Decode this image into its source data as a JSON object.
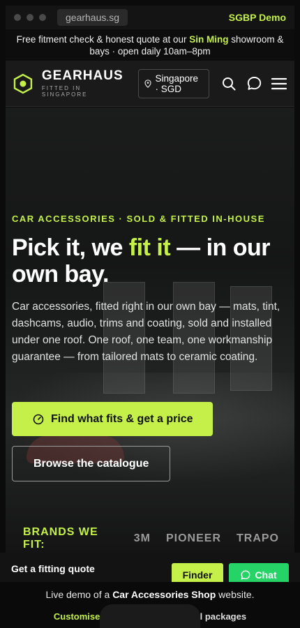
{
  "browser": {
    "url": "gearhaus.sg",
    "demo_label": "SGBP Demo"
  },
  "announcement": {
    "before": "Free fitment check & honest quote at our ",
    "highlight": "Sin Ming",
    "after": " showroom & bays · open daily 10am–8pm"
  },
  "header": {
    "brand_name": "GEARHAUS",
    "brand_tagline": "FITTED IN SINGAPORE",
    "region_label": "Singapore · SGD",
    "icons": [
      "search-icon",
      "chat-icon",
      "menu-icon"
    ]
  },
  "hero": {
    "eyebrow": "CAR ACCESSORIES · SOLD & FITTED IN-HOUSE",
    "headline_before": "Pick it, we ",
    "headline_highlight": "fit it",
    "headline_after": " — in our own bay.",
    "lede": "Car accessories, fitted right in our own bay — mats, tint, dashcams, audio, trims and coating, sold and installed under one roof. One roof, one team, one workmanship guarantee — from tailored mats to ceramic coating.",
    "primary_cta": "Find what fits & get a price",
    "secondary_cta": "Browse the catalogue"
  },
  "brands": {
    "label": "BRANDS WE FIT:",
    "items": [
      "3M",
      "PIONEER",
      "TRAPO"
    ]
  },
  "quote_bar": {
    "title": "Get a fitting quote",
    "finder_label": "Finder",
    "chat_label": "Chat"
  },
  "demo_bar": {
    "before": "Live demo of a ",
    "bold": "Car Accessories Shop",
    "after": " website.",
    "customise_link": "Customise & buy this site →",
    "packages_link": "All packages"
  },
  "colors": {
    "accent": "#c4f049",
    "whatsapp": "#25d366",
    "background": "#0b0b0b"
  }
}
